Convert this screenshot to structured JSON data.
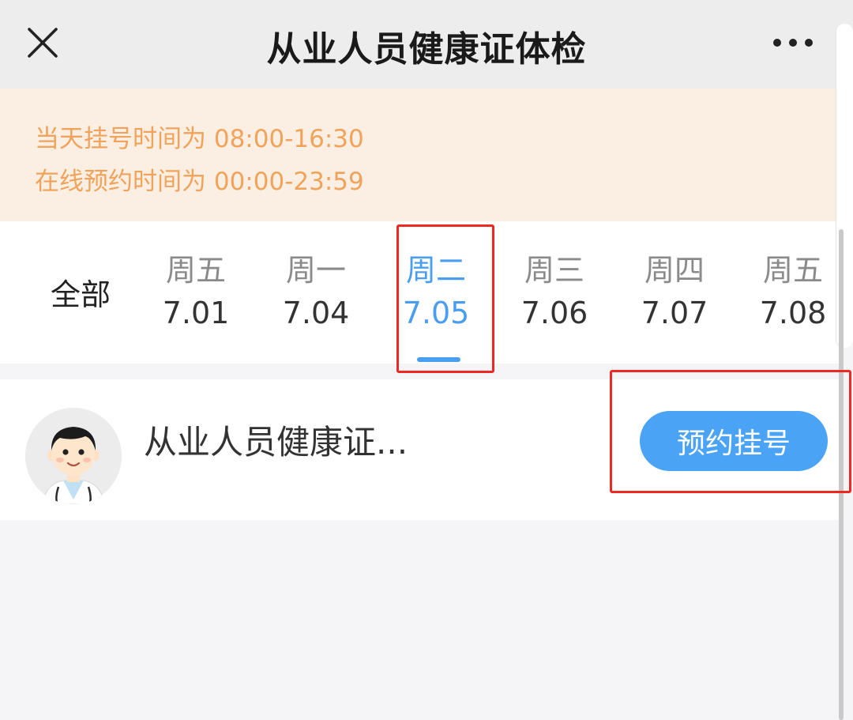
{
  "header": {
    "title": "从业人员健康证体检",
    "close_icon": "close-icon",
    "more_icon": "more-dots-icon"
  },
  "notice": {
    "registration_hours": "当天挂号时间为 08:00-16:30",
    "online_booking_hours": "在线预约时间为 00:00-23:59"
  },
  "date_tabs": {
    "all_label": "全部",
    "items": [
      {
        "weekday": "周五",
        "date": "7.01",
        "active": false
      },
      {
        "weekday": "周一",
        "date": "7.04",
        "active": false
      },
      {
        "weekday": "周二",
        "date": "7.05",
        "active": true
      },
      {
        "weekday": "周三",
        "date": "7.06",
        "active": false
      },
      {
        "weekday": "周四",
        "date": "7.07",
        "active": false
      },
      {
        "weekday": "周五",
        "date": "7.08",
        "active": false
      }
    ]
  },
  "service": {
    "name": "从业人员健康证...",
    "book_label": "预约挂号",
    "avatar_icon": "doctor-avatar-icon"
  },
  "colors": {
    "accent": "#4a9ef0",
    "button": "#4ba3f5",
    "notice_text": "#f0a35a",
    "notice_bg": "#fbeee2",
    "highlight": "#ec2a23"
  }
}
